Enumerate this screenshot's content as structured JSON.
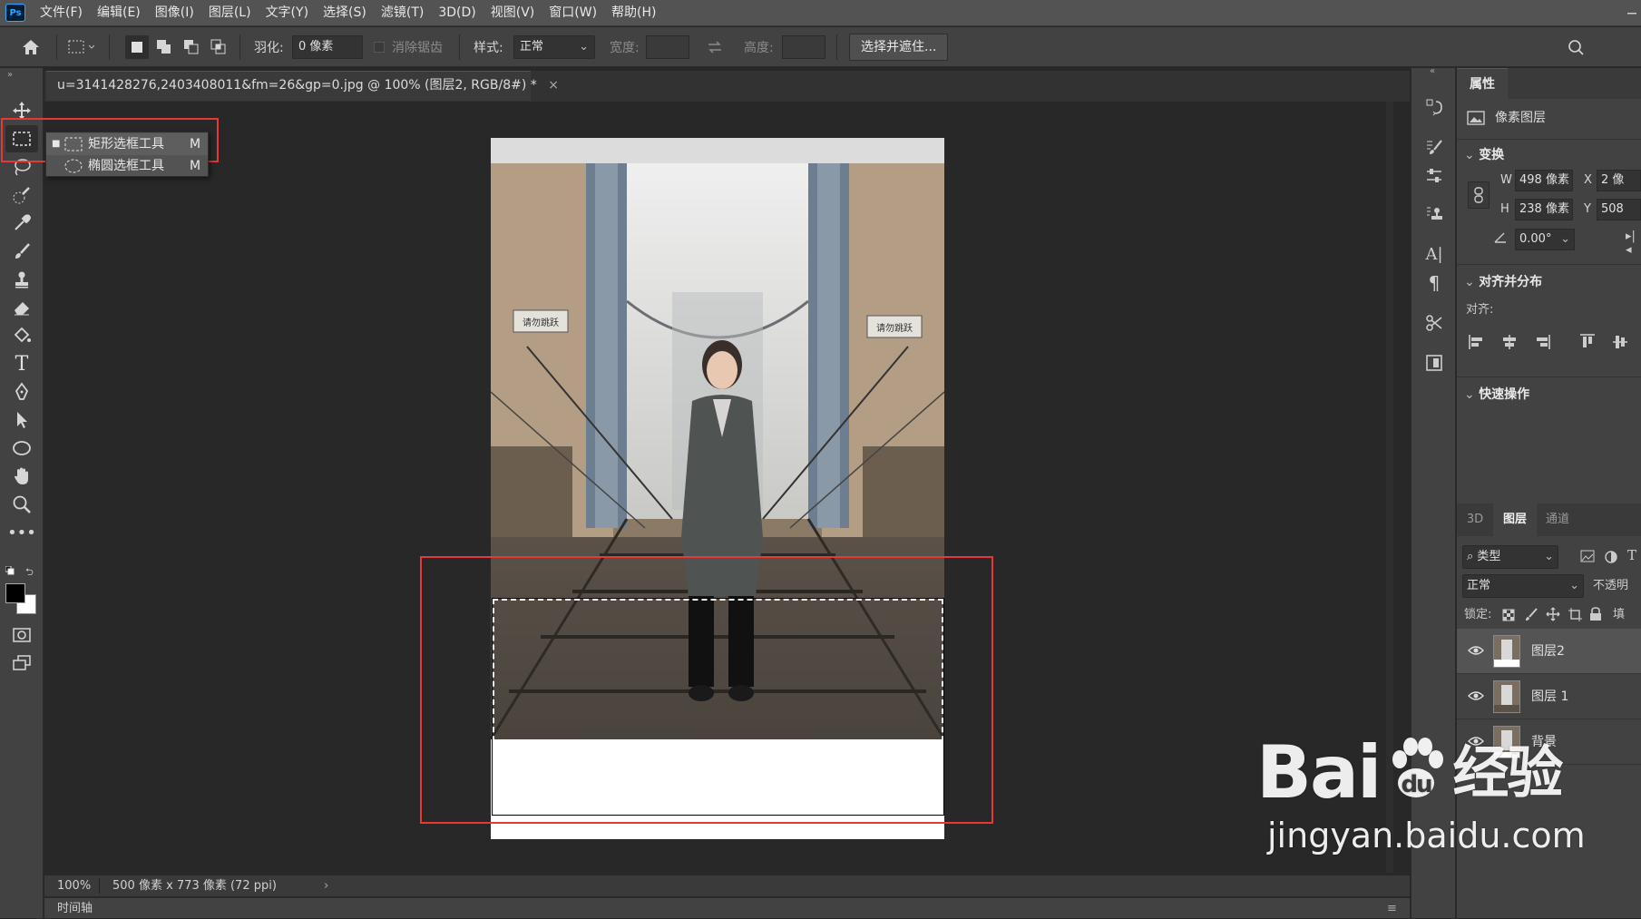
{
  "app": {
    "logo": "Ps"
  },
  "menu": [
    "文件(F)",
    "编辑(E)",
    "图像(I)",
    "图层(L)",
    "文字(Y)",
    "选择(S)",
    "滤镜(T)",
    "3D(D)",
    "视图(V)",
    "窗口(W)",
    "帮助(H)"
  ],
  "options": {
    "feather_label": "羽化:",
    "feather_value": "0 像素",
    "antialias_label": "消除锯齿",
    "style_label": "样式:",
    "style_value": "正常",
    "width_label": "宽度:",
    "height_label": "高度:",
    "select_mask_button": "选择并遮住..."
  },
  "document": {
    "tab_title": "u=3141428276,2403408011&fm=26&gp=0.jpg @ 100% (图层2, RGB/8#) *",
    "zoom": "100%",
    "info": "500 像素 x 773 像素 (72 ppi)",
    "photo_signs": [
      "请勿跳跃",
      "请勿跳跃"
    ]
  },
  "flyout": {
    "items": [
      {
        "label": "矩形选框工具",
        "shortcut": "M",
        "icon": "rect-marquee-icon",
        "active": true
      },
      {
        "label": "椭圆选框工具",
        "shortcut": "M",
        "icon": "ellipse-marquee-icon",
        "active": false
      }
    ]
  },
  "bottom": {
    "timeline_tab": "时间轴"
  },
  "properties": {
    "tab": "属性",
    "layer_type": "像素图层",
    "transform_header": "变换",
    "w_label": "W",
    "w_value": "498 像素",
    "x_label": "X",
    "x_value": "2 像",
    "h_label": "H",
    "h_value": "238 像素",
    "y_label": "Y",
    "y_value": "508",
    "angle_value": "0.00°",
    "align_header": "对齐并分布",
    "align_label": "对齐:",
    "quick_header": "快速操作"
  },
  "layers_panel": {
    "tabs": [
      "3D",
      "图层",
      "通道"
    ],
    "active_tab": "图层",
    "filter_kind": "类型",
    "blend_mode": "正常",
    "opacity_label": "不透明",
    "lock_label": "锁定:",
    "fill_label": "填",
    "layers": [
      {
        "name": "图层2",
        "selected": true
      },
      {
        "name": "图层 1",
        "selected": false
      },
      {
        "name": "背景",
        "selected": false
      }
    ]
  },
  "watermark": {
    "brand": "Bai",
    "brand_tail": "经验",
    "url": "jingyan.baidu.com"
  },
  "colors": {
    "highlight_red": "#e53935",
    "ui_dark": "#424242",
    "ui_canvas": "#282828",
    "accent_ps": "#31a8ff"
  }
}
